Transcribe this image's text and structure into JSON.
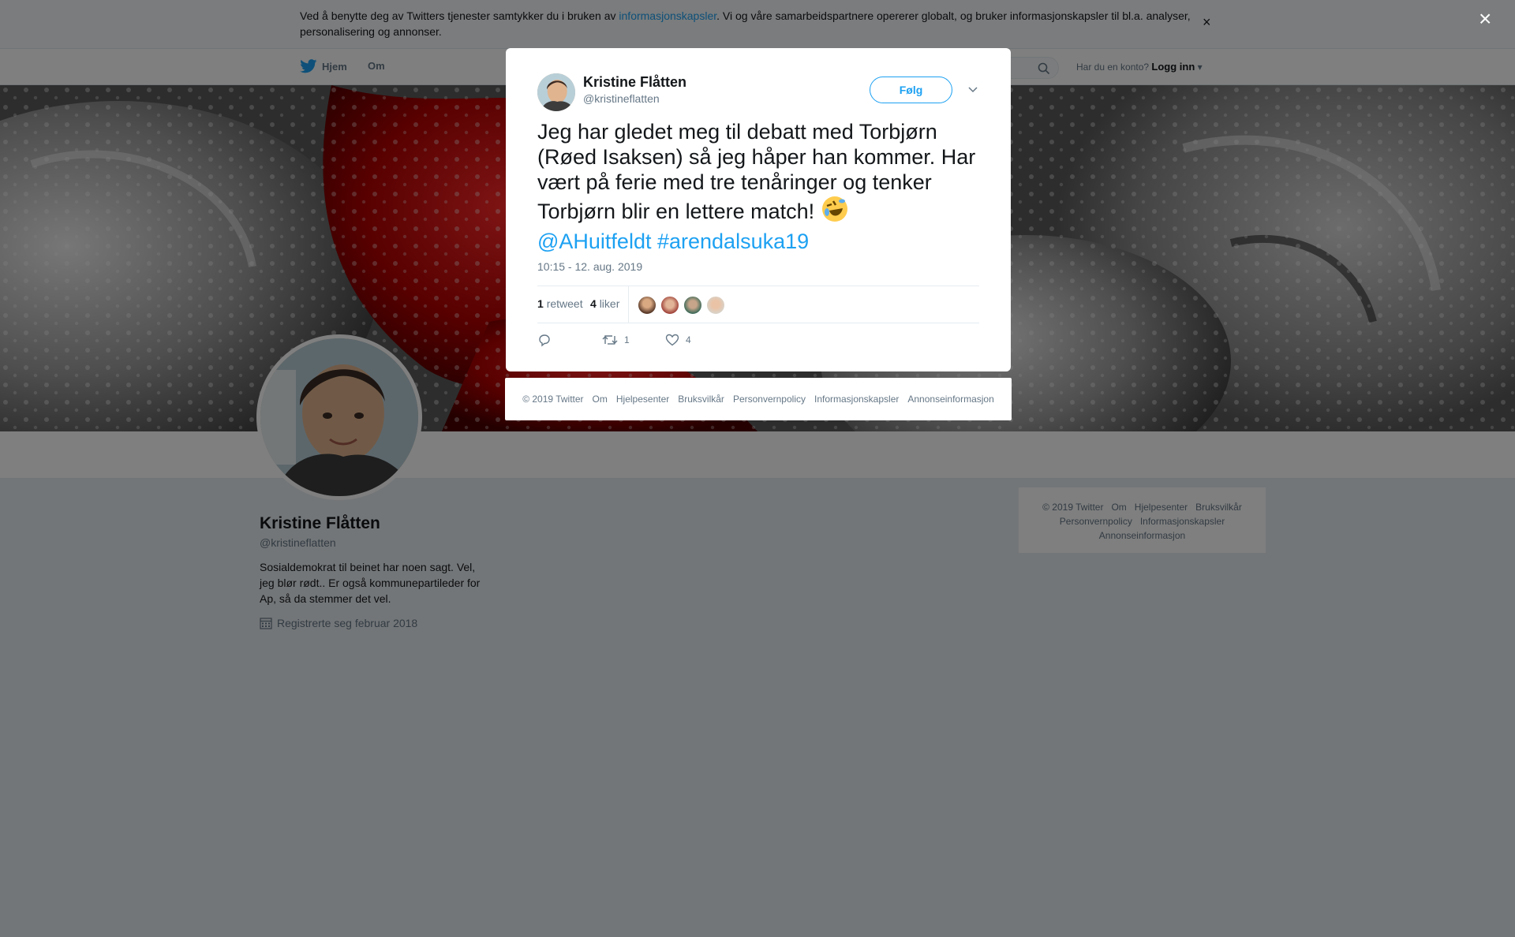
{
  "cookie_banner": {
    "text_before": "Ved å benytte deg av Twitters tjenester samtykker du i bruken av ",
    "link": "informasjonskapsler",
    "text_after": ". Vi og våre samarbeidspartnere opererer globalt, og bruker informasjonskapsler til bl.a. analyser, personalisering og annonser.",
    "close": "×"
  },
  "nav": {
    "home": "Hjem",
    "about": "Om",
    "login_prompt": "Har du en konto?",
    "login": "Logg inn"
  },
  "profile": {
    "name": "Kristine Flåtten",
    "handle": "@kristineflatten",
    "bio": "Sosialdemokrat til beinet har noen sagt. Vel, jeg blør rødt.. Er også kommunepartileder for Ap, så da stemmer det vel.",
    "joined": "Registrerte seg februar 2018"
  },
  "side_footer": {
    "row1": [
      "© 2019 Twitter",
      "Om",
      "Hjelpesenter",
      "Bruksvilkår"
    ],
    "row2": [
      "Personvernpolicy",
      "Informasjonskapsler"
    ],
    "row3": [
      "Annonseinformasjon"
    ]
  },
  "overlay_close": "×",
  "tweet": {
    "author_name": "Kristine Flåtten",
    "author_handle": "@kristineflatten",
    "follow": "Følg",
    "text": "Jeg har gledet meg til debatt med Torbjørn (Røed Isaksen) så jeg håper han kommer. Har vært på ferie med tre tenåringer og tenker Torbjørn blir en lettere match! ",
    "mention": "@AHuitfeldt",
    "hashtag": "#arendalsuka19",
    "timestamp": "10:15 - 12. aug. 2019",
    "retweet_count": "1",
    "retweet_label": "retweet",
    "like_count": "4",
    "like_label": "liker",
    "action_retweets": "1",
    "action_likes": "4"
  },
  "modal_footer": [
    "© 2019 Twitter",
    "Om",
    "Hjelpesenter",
    "Bruksvilkår",
    "Personvernpolicy",
    "Informasjonskapsler",
    "Annonseinformasjon"
  ],
  "colors": {
    "accent": "#1da1f2",
    "text": "#14171a",
    "muted": "#657786",
    "page_bg": "#e6ecf0"
  }
}
